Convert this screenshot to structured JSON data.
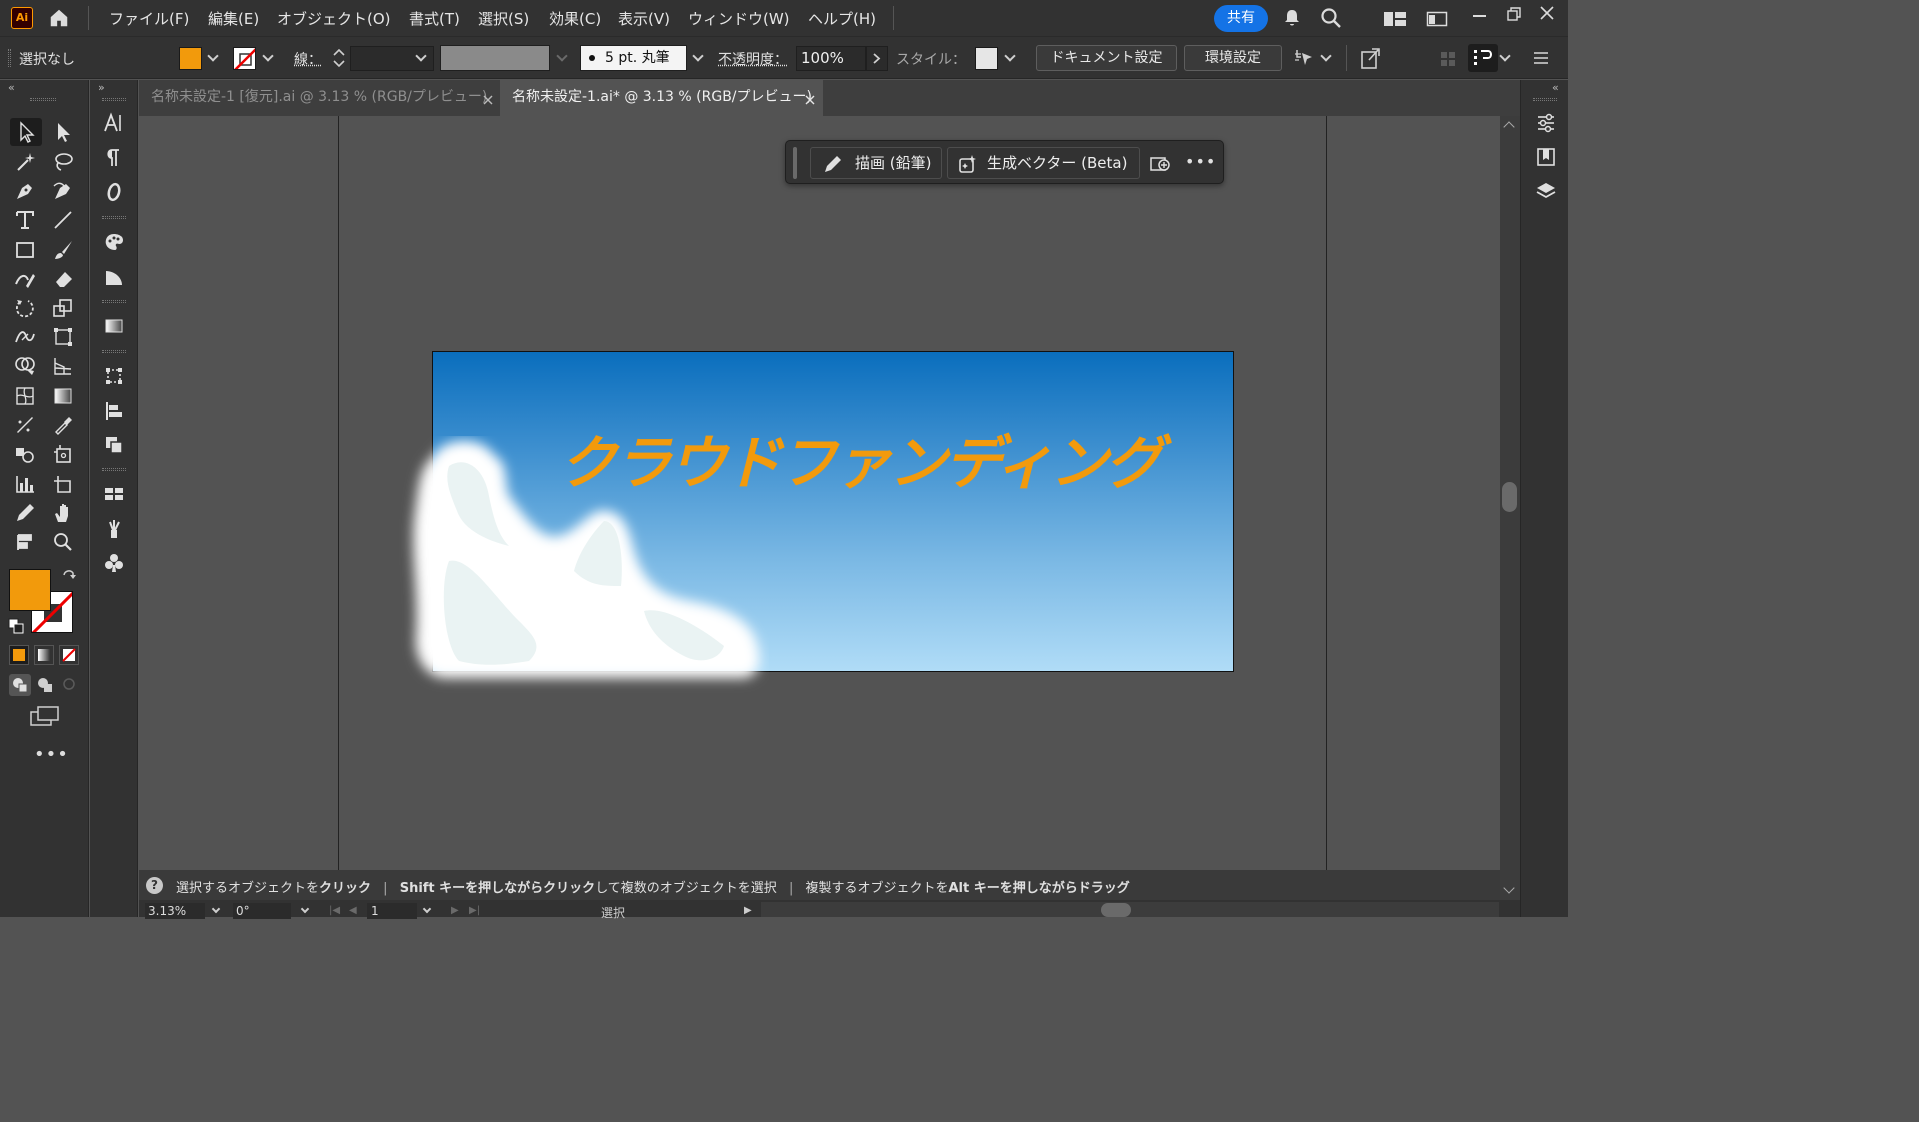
{
  "app": {
    "logo": "Ai",
    "home_icon": "home-icon"
  },
  "menu": [
    "ファイル(F)",
    "編集(E)",
    "オブジェクト(O)",
    "書式(T)",
    "選択(S)",
    "効果(C)",
    "表示(V)",
    "ウィンドウ(W)",
    "ヘルプ(H)"
  ],
  "header": {
    "share_label": "共有"
  },
  "control": {
    "selection": "選択なし",
    "stroke_label": "線",
    "brush_label": "5 pt. 丸筆",
    "opacity_label": "不透明度",
    "opacity_value": "100%",
    "style_label": "スタイル",
    "doc_settings": "ドキュメント設定",
    "preferences": "環境設定"
  },
  "colors": {
    "fill": "#f29a0c",
    "accent": "#1473e6",
    "sky_top": "#0a6ebd",
    "sky_bottom": "#b0dcf7"
  },
  "tabs": [
    {
      "label": "名称未設定-1 [復元].ai @ 3.13 % (RGB/プレビュー)",
      "active": false
    },
    {
      "label": "名称未設定-1.ai* @ 3.13 % (RGB/プレビュー)",
      "active": true
    }
  ],
  "contextual": {
    "draw_label": "描画 (鉛筆)",
    "genvector_label": "生成ベクター (Beta)"
  },
  "artwork": {
    "title": "クラウドファンディング"
  },
  "status": {
    "p1": "選択するオブジェクトを",
    "p1b": "クリック",
    "sep1": "|",
    "p2b": "Shift キーを押しながらクリック",
    "p2": "して複数のオブジェクトを選択",
    "sep2": "|",
    "p3": "複製するオブジェクトを",
    "p3b": "Alt キーを押しながらドラッグ"
  },
  "bottom": {
    "zoom": "3.13%",
    "rotation": "0°",
    "artboard": "1",
    "tool": "選択"
  }
}
